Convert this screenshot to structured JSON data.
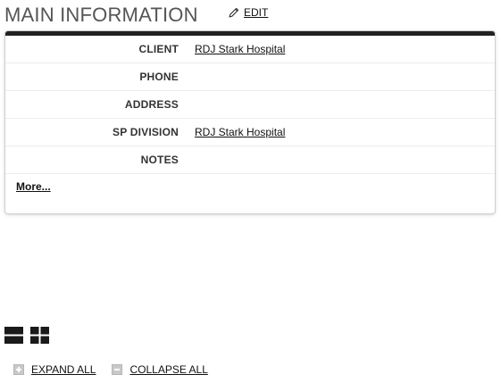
{
  "header": {
    "title": "MAIN INFORMATION",
    "edit_label": "EDIT"
  },
  "fields": [
    {
      "label": "CLIENT",
      "value": "RDJ Stark Hospital"
    },
    {
      "label": "PHONE",
      "value": ""
    },
    {
      "label": "ADDRESS",
      "value": ""
    },
    {
      "label": "SP DIVISION",
      "value": "RDJ Stark Hospital"
    },
    {
      "label": "NOTES",
      "value": ""
    }
  ],
  "more_label": "More...",
  "view_toggles": {
    "list_icon": "list-view-icon",
    "grid_icon": "grid-view-icon"
  },
  "controls": {
    "expand_label": "EXPAND ALL",
    "collapse_label": "COLLAPSE ALL"
  }
}
